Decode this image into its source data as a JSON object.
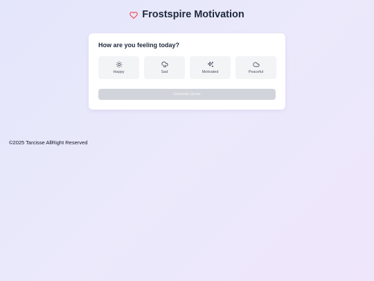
{
  "header": {
    "title": "Frostspire Motivation",
    "heart_color": "#ef4444"
  },
  "card": {
    "question": "How are you feeling today?",
    "moods": [
      {
        "label": "Happy",
        "icon": "sun-icon"
      },
      {
        "label": "Sad",
        "icon": "cloud-rain-icon"
      },
      {
        "label": "Motivated",
        "icon": "sparkles-icon"
      },
      {
        "label": "Peaceful",
        "icon": "cloud-icon"
      }
    ],
    "generate_label": "Generate Quote"
  },
  "footer": {
    "text": "©2025 Tarcisse AllRight Reserved"
  }
}
